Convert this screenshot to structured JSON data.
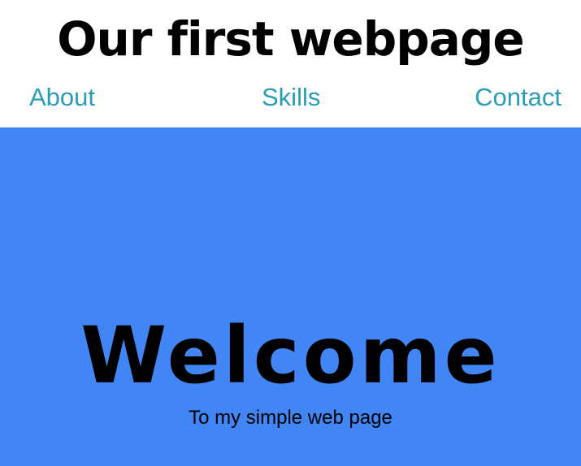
{
  "header": {
    "title": "Our first webpage",
    "nav": [
      {
        "label": "About"
      },
      {
        "label": "Skills"
      },
      {
        "label": "Contact"
      }
    ]
  },
  "hero": {
    "title": "Welcome",
    "subtitle": "To my simple web page"
  },
  "colors": {
    "hero_background": "#4285f4",
    "nav_link": "#2a9db5",
    "text": "#000000",
    "header_background": "#ffffff"
  }
}
